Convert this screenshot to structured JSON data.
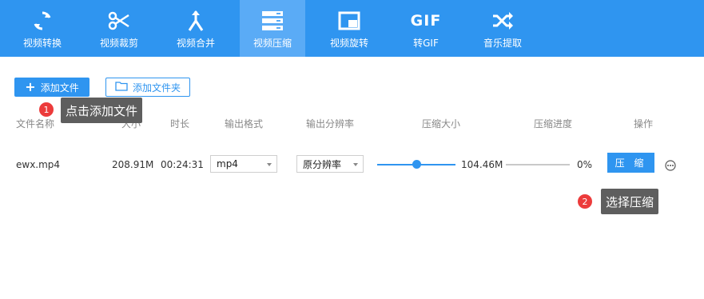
{
  "toolbar": {
    "items": [
      {
        "label": "视频转换",
        "icon": "convert-icon"
      },
      {
        "label": "视频裁剪",
        "icon": "scissors-icon"
      },
      {
        "label": "视频合并",
        "icon": "merge-icon"
      },
      {
        "label": "视频压缩",
        "icon": "compress-icon",
        "active": true
      },
      {
        "label": "视频旋转",
        "icon": "rotate-icon"
      },
      {
        "label": "转GIF",
        "icon": "gif-icon"
      },
      {
        "label": "音乐提取",
        "icon": "shuffle-icon"
      }
    ],
    "gif_glyph": "GIF",
    "background": "#2f95f0",
    "active_background": "#5aabf6"
  },
  "actions": {
    "add_file": "添加文件",
    "add_folder": "添加文件夹"
  },
  "table": {
    "headers": {
      "name": "文件名称",
      "size": "大小",
      "duration": "时长",
      "format": "输出格式",
      "resolution": "输出分辨率",
      "compressed_size": "压缩大小",
      "progress": "压缩进度",
      "operation": "操作"
    },
    "row": {
      "name": "ewx.mp4",
      "size": "208.91M",
      "duration": "00:24:31",
      "format": "mp4",
      "resolution": "原分辨率",
      "compressed_size": "104.46M",
      "compression_ratio": 0.45,
      "progress": "0%",
      "compress_button": "压 缩"
    }
  },
  "tips": [
    {
      "number": "1",
      "text": "点击添加文件"
    },
    {
      "number": "2",
      "text": "选择压缩"
    }
  ],
  "accent": "#2f95f0",
  "badge_color": "#ec3b3b"
}
